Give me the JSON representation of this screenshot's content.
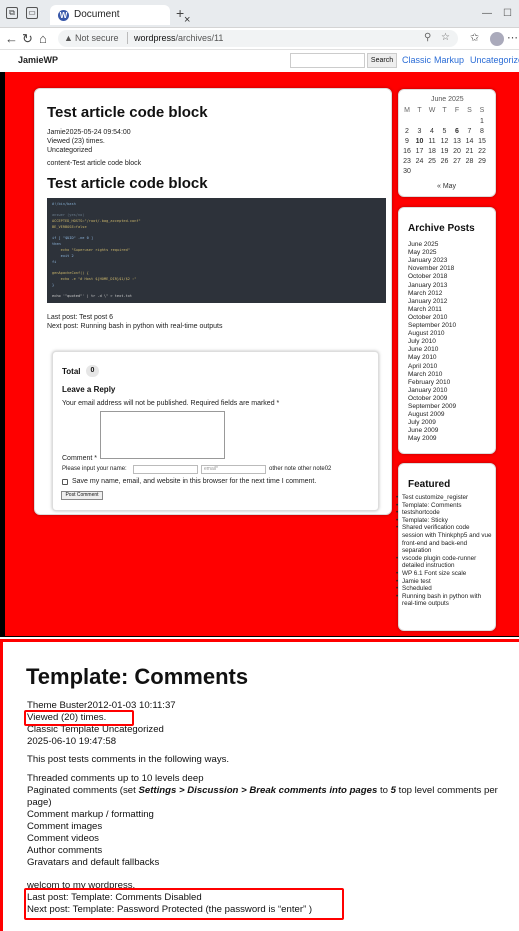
{
  "browser": {
    "tab_title": "Document",
    "tab_close": "×",
    "new_tab": "+",
    "minimize": "—",
    "maximize": "☐",
    "security_label": "Not secure",
    "url_domain": "wordpress",
    "url_path": "/archives/11"
  },
  "site": {
    "logo": "JamieWP",
    "search_placeholder": "",
    "search_button": "Search",
    "nav": [
      "Classic",
      "Markup",
      "Uncategorized"
    ]
  },
  "article": {
    "title": "Test article code block",
    "meta_author_date": "Jamie2025-05-24 09:54:00",
    "meta_views": "Viewed (23) times.",
    "meta_category": "Uncategorized",
    "content": "content-Test article code block",
    "heading2": "Test article code block",
    "code_lines": [
      "#!/bin/bash",
      "",
      "answer (yes/no)",
      "ACCEPTED_HOSTS=\"/root/.bag_accepted.conf\"",
      "BE_VERBOSE=false",
      "",
      "if [ \"$UID\" -ne 0 ]",
      "then",
      "    echo \"Superuser rights required\"",
      "    exit 2",
      "fi",
      "",
      "genApacheConf() {",
      "    echo -e \"# Host ${HOME_DIR}$1/$2 :\"",
      "}",
      "",
      "echo '\"quoted\"' | tr -d \\\" > text.txt"
    ],
    "last_post": "Last post:  Test post 6",
    "next_post": "Next post:  Running bash in python with real-time outputs"
  },
  "comments": {
    "total_label": "Total",
    "total_count": "0",
    "reply_title": "Leave a Reply",
    "notice": "Your email address will not be published. Required fields are marked *",
    "comment_label": "Comment *",
    "name_prompt": "Please input your name:",
    "email_placeholder": "email*",
    "other_note": "other note other note02",
    "save_info": "Save my name, email, and website in this browser for the next time I comment.",
    "post_button": "Post Comment"
  },
  "calendar": {
    "title": "June 2025",
    "weekdays": [
      "M",
      "T",
      "W",
      "T",
      "F",
      "S",
      "S"
    ],
    "rows": [
      [
        "",
        "",
        "",
        "",
        "",
        "",
        "1"
      ],
      [
        "2",
        "3",
        "4",
        "5",
        "6",
        "7",
        "8"
      ],
      [
        "9",
        "10",
        "11",
        "12",
        "13",
        "14",
        "15"
      ],
      [
        "16",
        "17",
        "18",
        "19",
        "20",
        "21",
        "22"
      ],
      [
        "23",
        "24",
        "25",
        "26",
        "27",
        "28",
        "29"
      ],
      [
        "30",
        "",
        "",
        "",
        "",
        "",
        ""
      ]
    ],
    "prev": "« May"
  },
  "archive": {
    "title": "Archive Posts",
    "items": [
      "June 2025",
      "May 2025",
      "January 2023",
      "November 2018",
      "October 2018",
      "January 2013",
      "March 2012",
      "January 2012",
      "March 2011",
      "October 2010",
      "September 2010",
      "August 2010",
      "July 2010",
      "June 2010",
      "May 2010",
      "April 2010",
      "March 2010",
      "February 2010",
      "January 2010",
      "October 2009",
      "September 2009",
      "August 2009",
      "July 2009",
      "June 2009",
      "May 2009"
    ]
  },
  "featured": {
    "title": "Featured",
    "items": [
      "Test customize_register",
      "Template: Comments",
      "testshortcode",
      "Template: Sticky",
      "Shared verification code session with Thinkphp5 and vue front-end and back-end separation",
      "vscode plugin code-runner detailed instruction",
      "WP 6.1 Font size scale",
      "Jamie test",
      "Scheduled",
      "Running bash in python with real-time outputs"
    ]
  },
  "bottom": {
    "title": "Template: Comments",
    "author_date": "Theme Buster2012-01-03 10:11:37",
    "views": "Viewed (20) times.",
    "categories": "Classic Template Uncategorized",
    "modified": "2025-06-10 19:47:58",
    "intro": "This post tests comments in the following ways.",
    "list_1": "Threaded comments up to 10 levels deep",
    "list_2_pre": "Paginated comments (set ",
    "list_2_bold": "Settings > Discussion > Break comments into pages",
    "list_2_mid": " to ",
    "list_2_num": "5",
    "list_2_post": " top level comments per page)",
    "list_3": "Comment markup / formatting",
    "list_4": "Comment images",
    "list_5": "Comment videos",
    "list_6": "Author comments",
    "list_7": "Gravatars and default fallbacks",
    "welcome": "welcom to my wordpress.",
    "last_post": "Last post:   Template: Comments Disabled",
    "next_post": "Next post:   Template: Password Protected (the password is  “enter” )"
  }
}
